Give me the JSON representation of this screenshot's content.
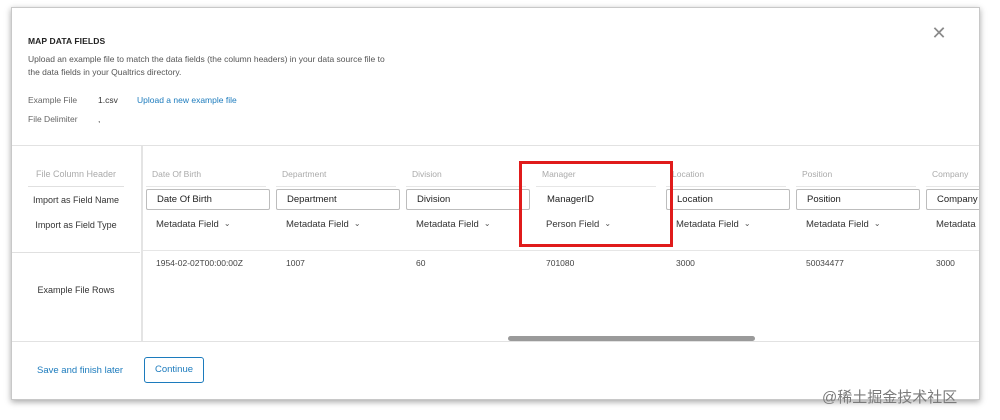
{
  "dialog": {
    "title": "MAP DATA FIELDS",
    "description": "Upload an example file to match the data fields (the column headers) in your data source file to the data fields in your Qualtrics directory.",
    "close_icon": "close-icon"
  },
  "file_info": {
    "example_file_label": "Example File",
    "example_file_value": "1.csv",
    "upload_link": "Upload a new example file",
    "delimiter_label": "File Delimiter",
    "delimiter_value": ","
  },
  "row_headers": {
    "file_column_header": "File Column Header",
    "import_field_name": "Import as Field Name",
    "import_field_type": "Import as Field Type",
    "example_rows": "Example File Rows"
  },
  "columns": [
    {
      "header": "Date Of Birth",
      "field_name": "Date Of Birth",
      "field_type": "Metadata Field",
      "example": "1954-02-02T00:00:00Z"
    },
    {
      "header": "Department",
      "field_name": "Department",
      "field_type": "Metadata Field",
      "example": "1007"
    },
    {
      "header": "Division",
      "field_name": "Division",
      "field_type": "Metadata Field",
      "example": "60"
    },
    {
      "header": "Manager",
      "field_name": "ManagerID",
      "field_type": "Person Field",
      "example": "701080"
    },
    {
      "header": "Location",
      "field_name": "Location",
      "field_type": "Metadata Field",
      "example": "3000"
    },
    {
      "header": "Position",
      "field_name": "Position",
      "field_type": "Metadata Field",
      "example": "50034477"
    },
    {
      "header": "Company",
      "field_name": "Company",
      "field_type": "Metadata Field",
      "example": "3000"
    }
  ],
  "footer": {
    "save_later": "Save and finish later",
    "continue": "Continue"
  },
  "watermark": "@稀土掘金技术社区",
  "colors": {
    "link": "#1c7bbd",
    "highlight": "#e01b1b",
    "border": "#bdbdbd"
  }
}
